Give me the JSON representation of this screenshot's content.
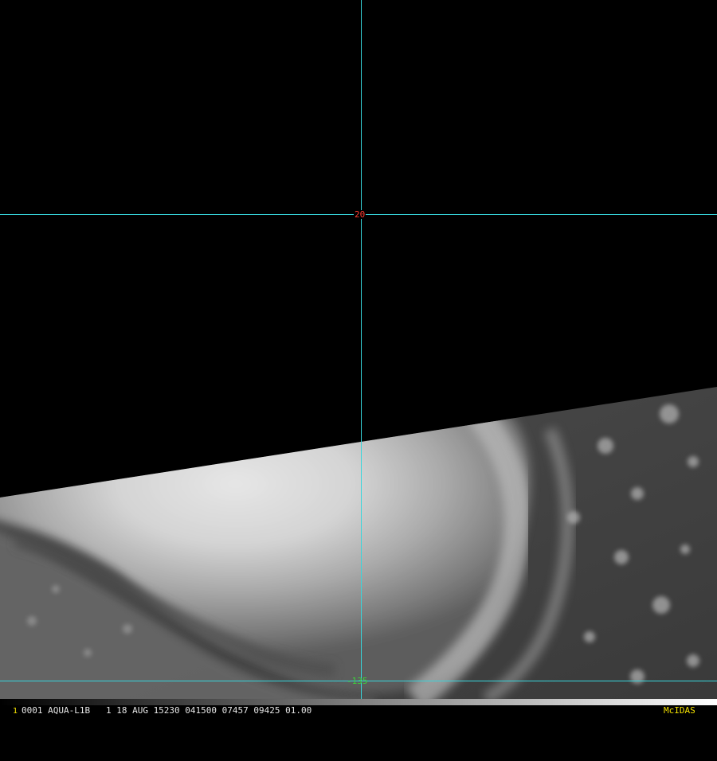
{
  "image": {
    "satellite_scene": "tropical-cyclone-visible-imagery",
    "colors": {
      "grid": "#37d6dc",
      "lat_label": "#ff3b30",
      "lon_label": "#3bd43b",
      "brand": "#f3e100"
    }
  },
  "grid": {
    "latitude_label": "20",
    "longitude_label": "-135"
  },
  "status_bar": {
    "frame_index": "1",
    "text": "0001 AQUA-L1B   1 18 AUG 15230 041500 07457 09425 01.00",
    "brand": "McIDAS"
  }
}
